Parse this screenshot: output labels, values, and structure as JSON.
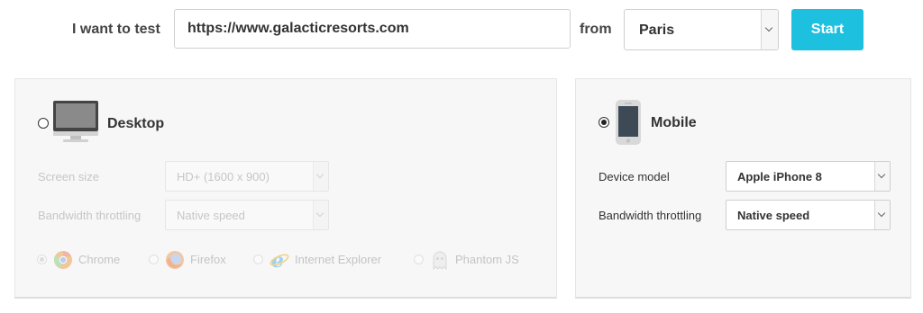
{
  "header": {
    "want_label": "I want to test",
    "url_value": "https://www.galacticresorts.com",
    "from_label": "from",
    "location_value": "Paris",
    "start_label": "Start",
    "accent_color": "#1ec0e0"
  },
  "desktop": {
    "title": "Desktop",
    "selected": false,
    "screen_size_label": "Screen size",
    "screen_size_value": "HD+ (1600 x 900)",
    "bandwidth_label": "Bandwidth throttling",
    "bandwidth_value": "Native speed",
    "browsers": [
      {
        "name": "Chrome",
        "icon": "chrome-icon",
        "selected": true
      },
      {
        "name": "Firefox",
        "icon": "firefox-icon",
        "selected": false
      },
      {
        "name": "Internet Explorer",
        "icon": "internet-explorer-icon",
        "selected": false
      },
      {
        "name": "Phantom JS",
        "icon": "phantomjs-ghost-icon",
        "selected": false
      }
    ]
  },
  "mobile": {
    "title": "Mobile",
    "selected": true,
    "device_label": "Device model",
    "device_value": "Apple iPhone 8",
    "bandwidth_label": "Bandwidth throttling",
    "bandwidth_value": "Native speed"
  }
}
